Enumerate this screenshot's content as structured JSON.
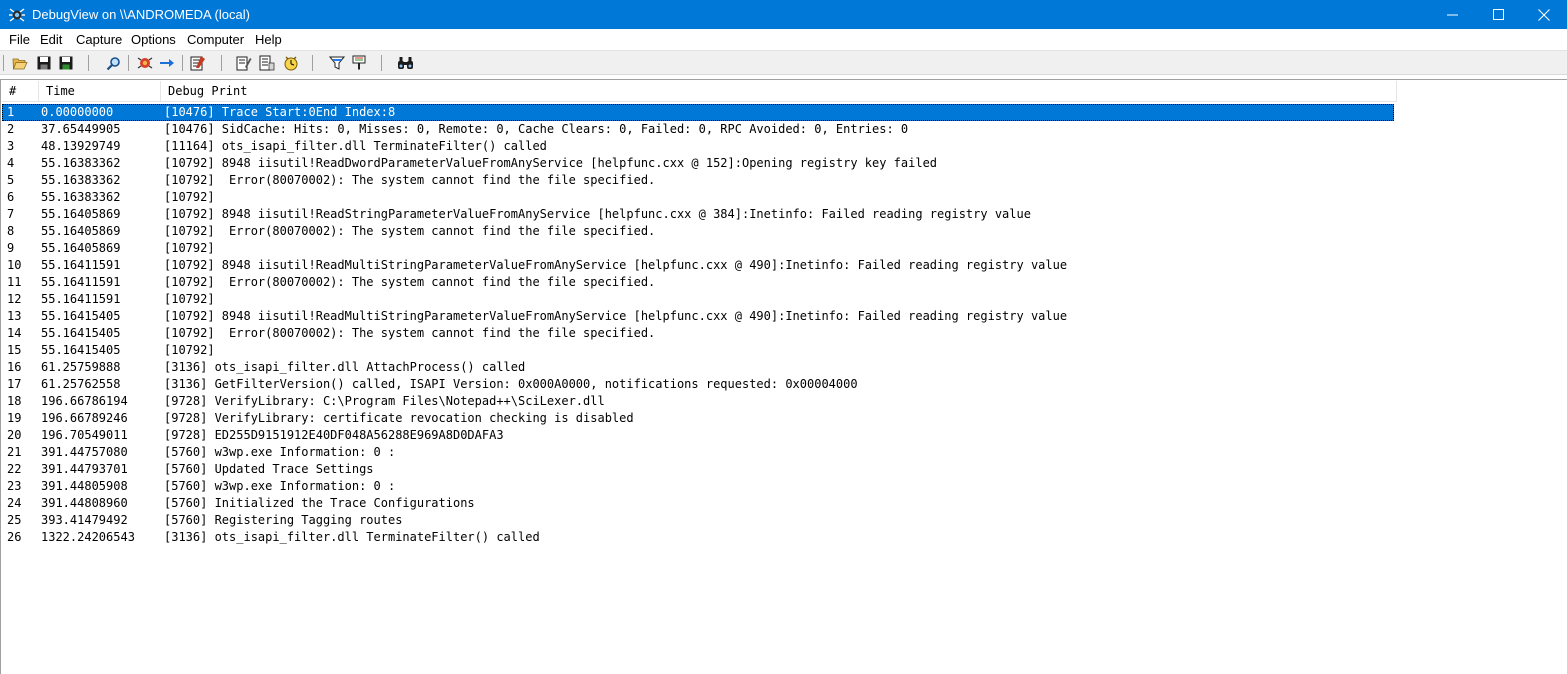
{
  "window": {
    "title": "DebugView on \\\\ANDROMEDA (local)",
    "controls": [
      "minimize",
      "maximize",
      "close"
    ]
  },
  "menu": [
    "File",
    "Edit",
    "Capture",
    "Options",
    "Computer",
    "Help"
  ],
  "toolbar": {
    "buttons": [
      {
        "name": "open-icon"
      },
      {
        "name": "save-icon"
      },
      {
        "name": "save-all-icon"
      },
      {
        "name": "find-icon"
      },
      {
        "name": "capture-icon"
      },
      {
        "name": "autoscroll-icon"
      },
      {
        "name": "clear-display-icon"
      },
      {
        "name": "time-format-icon"
      },
      {
        "name": "clock-time-icon"
      },
      {
        "name": "show-milliseconds-icon"
      },
      {
        "name": "filter-icon"
      },
      {
        "name": "highlight-icon"
      },
      {
        "name": "binoculars-icon"
      }
    ]
  },
  "columns": [
    "#",
    "Time",
    "Debug Print"
  ],
  "rows": [
    {
      "num": "1",
      "time": "0.00000000",
      "msg": "[10476] Trace Start:0End Index:8"
    },
    {
      "num": "2",
      "time": "37.65449905",
      "msg": "[10476] SidCache: Hits: 0, Misses: 0, Remote: 0, Cache Clears: 0, Failed: 0, RPC Avoided: 0, Entries: 0"
    },
    {
      "num": "3",
      "time": "48.13929749",
      "msg": "[11164] ots_isapi_filter.dll TerminateFilter() called"
    },
    {
      "num": "4",
      "time": "55.16383362",
      "msg": "[10792] 8948 iisutil!ReadDwordParameterValueFromAnyService [helpfunc.cxx @ 152]:Opening registry key failed"
    },
    {
      "num": "5",
      "time": "55.16383362",
      "msg": "[10792]  Error(80070002): The system cannot find the file specified."
    },
    {
      "num": "6",
      "time": "55.16383362",
      "msg": "[10792]"
    },
    {
      "num": "7",
      "time": "55.16405869",
      "msg": "[10792] 8948 iisutil!ReadStringParameterValueFromAnyService [helpfunc.cxx @ 384]:Inetinfo: Failed reading registry value"
    },
    {
      "num": "8",
      "time": "55.16405869",
      "msg": "[10792]  Error(80070002): The system cannot find the file specified."
    },
    {
      "num": "9",
      "time": "55.16405869",
      "msg": "[10792]"
    },
    {
      "num": "10",
      "time": "55.16411591",
      "msg": "[10792] 8948 iisutil!ReadMultiStringParameterValueFromAnyService [helpfunc.cxx @ 490]:Inetinfo: Failed reading registry value"
    },
    {
      "num": "11",
      "time": "55.16411591",
      "msg": "[10792]  Error(80070002): The system cannot find the file specified."
    },
    {
      "num": "12",
      "time": "55.16411591",
      "msg": "[10792]"
    },
    {
      "num": "13",
      "time": "55.16415405",
      "msg": "[10792] 8948 iisutil!ReadMultiStringParameterValueFromAnyService [helpfunc.cxx @ 490]:Inetinfo: Failed reading registry value"
    },
    {
      "num": "14",
      "time": "55.16415405",
      "msg": "[10792]  Error(80070002): The system cannot find the file specified."
    },
    {
      "num": "15",
      "time": "55.16415405",
      "msg": "[10792]"
    },
    {
      "num": "16",
      "time": "61.25759888",
      "msg": "[3136] ots_isapi_filter.dll AttachProcess() called"
    },
    {
      "num": "17",
      "time": "61.25762558",
      "msg": "[3136] GetFilterVersion() called, ISAPI Version: 0x000A0000, notifications requested: 0x00004000"
    },
    {
      "num": "18",
      "time": "196.66786194",
      "msg": "[9728] VerifyLibrary: C:\\Program Files\\Notepad++\\SciLexer.dll"
    },
    {
      "num": "19",
      "time": "196.66789246",
      "msg": "[9728] VerifyLibrary: certificate revocation checking is disabled"
    },
    {
      "num": "20",
      "time": "196.70549011",
      "msg": "[9728] ED255D9151912E40DF048A56288E969A8D0DAFA3"
    },
    {
      "num": "21",
      "time": "391.44757080",
      "msg": "[5760] w3wp.exe Information: 0 :"
    },
    {
      "num": "22",
      "time": "391.44793701",
      "msg": "[5760] Updated Trace Settings"
    },
    {
      "num": "23",
      "time": "391.44805908",
      "msg": "[5760] w3wp.exe Information: 0 :"
    },
    {
      "num": "24",
      "time": "391.44808960",
      "msg": "[5760] Initialized the Trace Configurations"
    },
    {
      "num": "25",
      "time": "393.41479492",
      "msg": "[5760] Registering Tagging routes"
    },
    {
      "num": "26",
      "time": "1322.24206543",
      "msg": "[3136] ots_isapi_filter.dll TerminateFilter() called"
    }
  ],
  "selected_row": 1,
  "colors": {
    "titlebar": "#0078d7",
    "selection": "#0078d7",
    "toolbar_bg": "#f0f0f0"
  }
}
